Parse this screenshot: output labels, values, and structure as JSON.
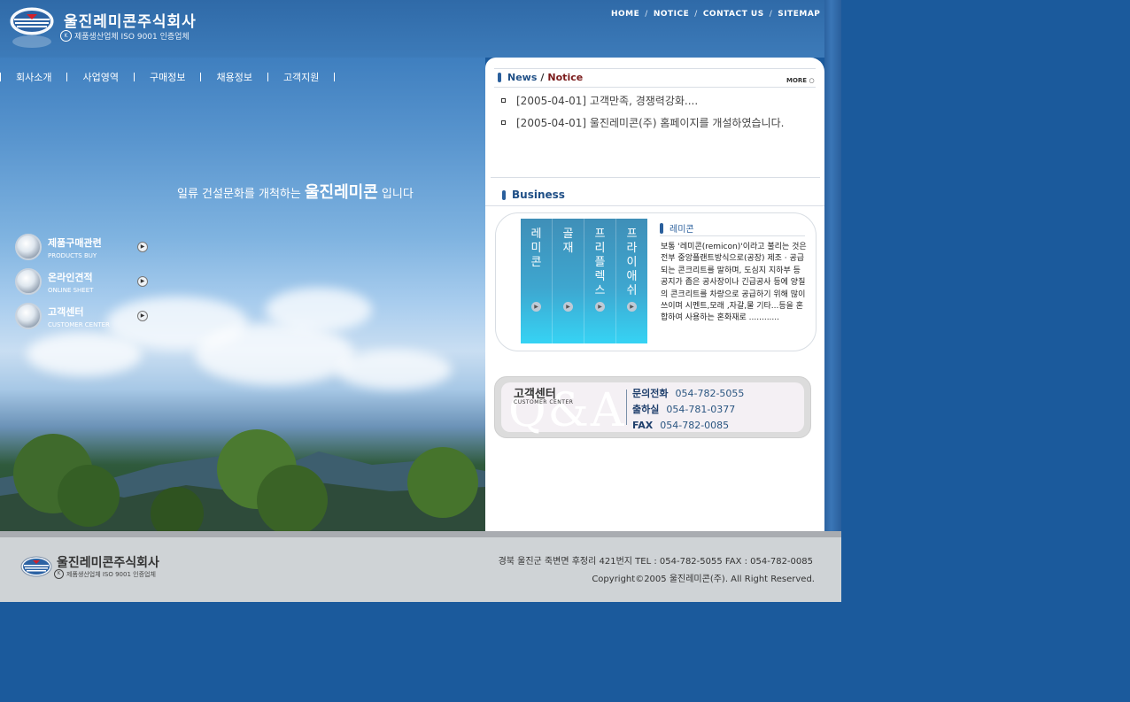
{
  "header": {
    "company_name": "울진레미콘주식회사",
    "iso_badge": "K",
    "subtitle": "제품생산업체 ISO 9001 인증업체",
    "top_links": [
      "HOME",
      "NOTICE",
      "CONTACT US",
      "SITEMAP"
    ],
    "separator": "/"
  },
  "main_nav": [
    "회사소개",
    "사업영역",
    "구매정보",
    "채용정보",
    "고객지원"
  ],
  "hero": {
    "slogan_prefix": "일류 건설문화를 개척하는",
    "slogan_brand": "울진레미콘",
    "slogan_suffix": "입니다"
  },
  "quick_links": [
    {
      "title": "제품구매관련",
      "subtitle": "PRODUCTS BUY"
    },
    {
      "title": "온라인견적",
      "subtitle": "ONLINE SHEET"
    },
    {
      "title": "고객센터",
      "subtitle": "CUSTOMER CENTER"
    }
  ],
  "news": {
    "title_news": "News",
    "title_sep": "/",
    "title_notice": "Notice",
    "more": "MORE",
    "items": [
      "[2005-04-01] 고객만족, 경쟁력강화....",
      "[2005-04-01] 울진레미콘(주) 홈페이지를 개설하였습니다."
    ]
  },
  "business": {
    "title": "Business",
    "columns": [
      "레미콘",
      "골재",
      "프리플렉스",
      "프라이애쉬"
    ],
    "detail_title": "레미콘",
    "detail_text": "보통 '레미콘(remicon)'이라고 불리는 것은 전부 중앙플랜트방식으로(공장) 제조 · 공급되는 콘크리트를 말하며, 도심지 지하부 등 공지가 좁은 공사장이나 긴급공사 등에 양질의 콘크리트를 차량으로 공급하기 위해 많이 쓰이며 시멘트,모래 ,자갈,물 기타...등을 혼합하여 사용하는 혼화재로 ............"
  },
  "customer_center": {
    "title": "고객센터",
    "subtitle": "CUSTOMER CENTER",
    "watermark": "Q&A",
    "contacts": [
      {
        "label": "문의전화",
        "value": "054-782-5055"
      },
      {
        "label": "출하실",
        "value": "054-781-0377"
      },
      {
        "label": "FAX",
        "value": "054-782-0085"
      }
    ]
  },
  "footer": {
    "company_name": "울진레미콘주식회사",
    "iso_badge": "K",
    "subtitle": "제품생산업체 ISO 9001 인증업체",
    "address": "경북 울진군 죽변면 후정리 421번지  TEL : 054-782-5055  FAX : 054-782-0085",
    "copyright": "Copyright©2005 울진레미콘(주). All Right Reserved."
  },
  "colors": {
    "background": "#1b5a9c",
    "panel": "#ffffff",
    "footer": "#cfd3d6",
    "accent": "#2a5f9c"
  },
  "icons": [
    "company-emblem-icon",
    "iso-badge-icon",
    "play-arrow-icon"
  ]
}
